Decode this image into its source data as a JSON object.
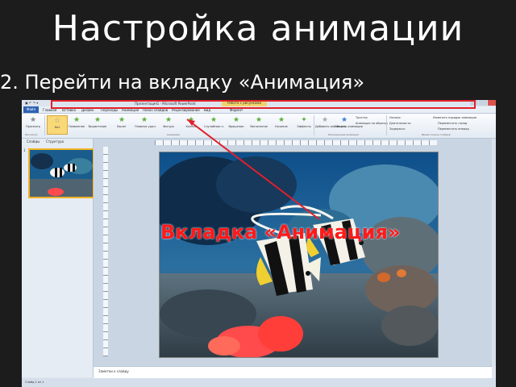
{
  "slide": {
    "title": "Настройка анимации",
    "bullet": "2. Перейти на вкладку «Анимация»",
    "callout": "Вкладка «Анимация»"
  },
  "powerpoint": {
    "window_title": "Презентация1 - Microsoft PowerPoint",
    "context_tab": "Работа с рисунками",
    "menu_tabs": [
      "Файл",
      "Главная",
      "Вставка",
      "Дизайн",
      "Переходы",
      "Анимация",
      "Показ слайдов",
      "Рецензирование",
      "Вид",
      "Формат"
    ],
    "ribbon": {
      "preview": "Просмотр",
      "effects": [
        "Нет",
        "Появление",
        "Выцветание",
        "Вылет",
        "Плавное удал.",
        "Фигура",
        "Колесо",
        "Случайные п.",
        "Вращение",
        "Увеличение",
        "Качание",
        "Эффекты"
      ],
      "params_label": "Параметры эффектов",
      "add_animation": "Добавить анимацию",
      "animation_panel": "Область анимации",
      "trigger": "Триггер",
      "painter": "Анимация по образцу",
      "start": "Начало:",
      "duration": "Длительность:",
      "delay": "Задержка:",
      "reorder": "Изменить порядок анимации",
      "move_earlier": "Переместить назад",
      "move_later": "Переместить вперед",
      "group_preview": "Просмотр",
      "group_animation": "Анимация",
      "group_advanced": "Расширенная анимация",
      "group_timing": "Время показа слайдов"
    },
    "panel_tabs": [
      "Слайды",
      "Структура"
    ],
    "slide_number": "1",
    "notes_placeholder": "Заметки к слайду",
    "status": "Слайд 1 из 1"
  },
  "colors": {
    "background": "#1c1c1c",
    "callout": "#ff1a1a",
    "highlight": "#e0202a"
  }
}
